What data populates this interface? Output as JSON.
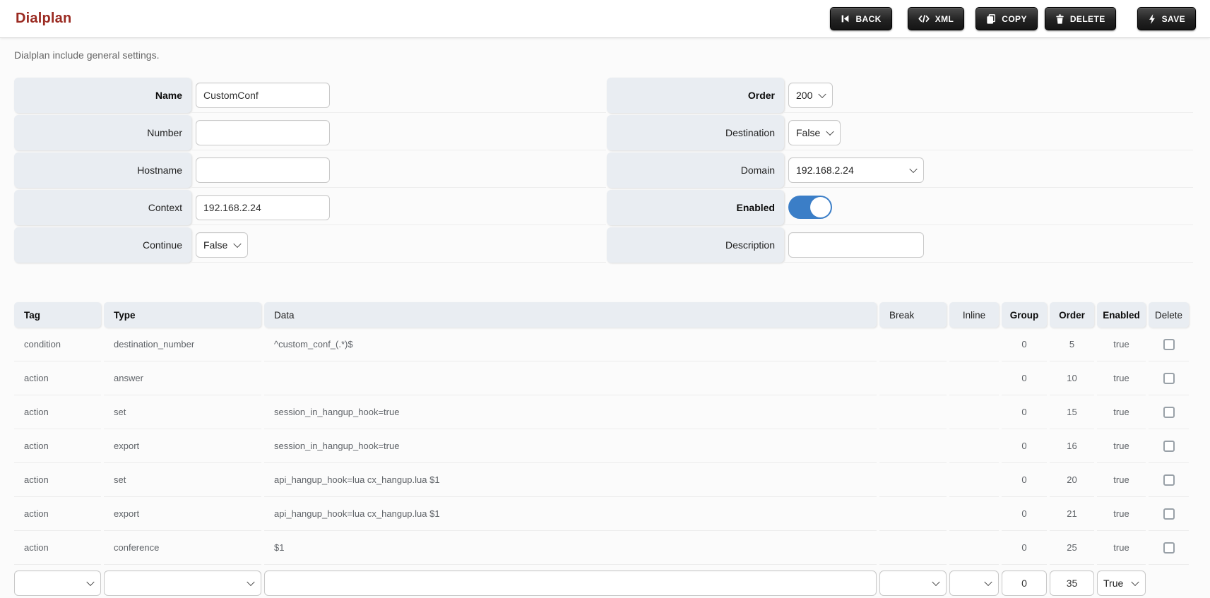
{
  "colors": {
    "brand_red": "#9a2a21",
    "toggle_blue": "#3b7ec7",
    "label_bg": "#e9edf2",
    "button_dark": "#1e1e1e"
  },
  "header": {
    "title": "Dialplan",
    "buttons": [
      {
        "label": "BACK",
        "icon": "skip-back-icon"
      },
      {
        "label": "XML",
        "icon": "code-icon"
      },
      {
        "label": "COPY",
        "icon": "copy-icon"
      },
      {
        "label": "DELETE",
        "icon": "trash-icon"
      },
      {
        "label": "SAVE",
        "icon": "lightning-icon"
      }
    ]
  },
  "subtitle": "Dialplan include general settings.",
  "form": {
    "left": [
      {
        "label": "Name",
        "control": "text",
        "value": "CustomConf"
      },
      {
        "label": "Number",
        "control": "text",
        "value": ""
      },
      {
        "label": "Hostname",
        "control": "text",
        "value": ""
      },
      {
        "label": "Context",
        "control": "text",
        "value": "192.168.2.24"
      },
      {
        "label": "Continue",
        "control": "select",
        "value": "False"
      }
    ],
    "right": [
      {
        "label": "Order",
        "control": "select",
        "value": "200"
      },
      {
        "label": "Destination",
        "control": "select",
        "value": "False"
      },
      {
        "label": "Domain",
        "control": "select",
        "value": "192.168.2.24"
      },
      {
        "label": "Enabled",
        "control": "toggle",
        "value": "on"
      },
      {
        "label": "Description",
        "control": "text",
        "value": ""
      }
    ]
  },
  "table": {
    "columns": [
      {
        "label": "Tag"
      },
      {
        "label": "Type"
      },
      {
        "label": "Data"
      },
      {
        "label": "Break"
      },
      {
        "label": "Inline"
      },
      {
        "label": "Group"
      },
      {
        "label": "Order"
      },
      {
        "label": "Enabled"
      },
      {
        "label": "Delete"
      }
    ],
    "rows": [
      {
        "tag": "condition",
        "type": "destination_number",
        "data": "^custom_conf_(.*)$",
        "group": "0",
        "order": "5",
        "enabled": "true"
      },
      {
        "tag": "action",
        "type": "answer",
        "data": "",
        "group": "0",
        "order": "10",
        "enabled": "true"
      },
      {
        "tag": "action",
        "type": "set",
        "data": "session_in_hangup_hook=true",
        "group": "0",
        "order": "15",
        "enabled": "true"
      },
      {
        "tag": "action",
        "type": "export",
        "data": "session_in_hangup_hook=true",
        "group": "0",
        "order": "16",
        "enabled": "true"
      },
      {
        "tag": "action",
        "type": "set",
        "data": "api_hangup_hook=lua cx_hangup.lua $1",
        "group": "0",
        "order": "20",
        "enabled": "true"
      },
      {
        "tag": "action",
        "type": "export",
        "data": "api_hangup_hook=lua cx_hangup.lua $1",
        "group": "0",
        "order": "21",
        "enabled": "true"
      },
      {
        "tag": "action",
        "type": "conference",
        "data": "$1",
        "group": "0",
        "order": "25",
        "enabled": "true"
      }
    ],
    "new_row": {
      "tag": "",
      "type": "",
      "data": "",
      "break": "",
      "inline": "",
      "group": "0",
      "order": "35",
      "enabled": "True"
    }
  }
}
